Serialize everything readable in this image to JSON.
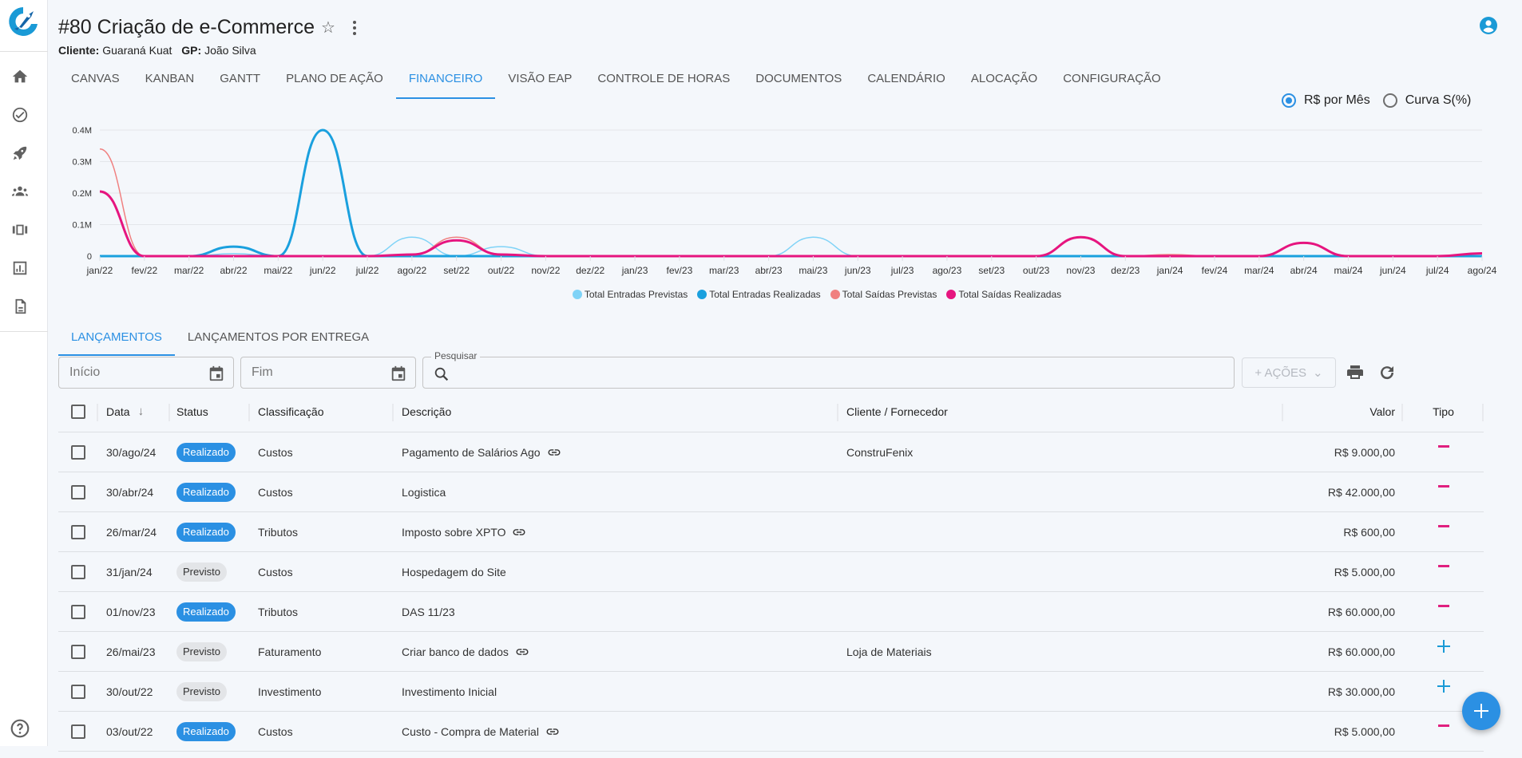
{
  "header": {
    "title": "#80 Criação de e-Commerce",
    "client_label": "Cliente:",
    "client_value": "Guaraná Kuat",
    "gp_label": "GP:",
    "gp_value": "João Silva"
  },
  "sidebar": {
    "items": [
      {
        "name": "home-icon"
      },
      {
        "name": "check-circle-icon"
      },
      {
        "name": "rocket-icon"
      },
      {
        "name": "groups-icon"
      },
      {
        "name": "view-carousel-icon"
      },
      {
        "name": "chart-icon"
      },
      {
        "name": "document-icon"
      }
    ],
    "help": "help-icon"
  },
  "tabs": [
    {
      "label": "CANVAS",
      "active": false
    },
    {
      "label": "KANBAN",
      "active": false
    },
    {
      "label": "GANTT",
      "active": false
    },
    {
      "label": "PLANO DE AÇÃO",
      "active": false
    },
    {
      "label": "FINANCEIRO",
      "active": true
    },
    {
      "label": "VISÃO EAP",
      "active": false
    },
    {
      "label": "CONTROLE DE HORAS",
      "active": false
    },
    {
      "label": "DOCUMENTOS",
      "active": false
    },
    {
      "label": "CALENDÁRIO",
      "active": false
    },
    {
      "label": "ALOCAÇÃO",
      "active": false
    },
    {
      "label": "CONFIGURAÇÃO",
      "active": false
    }
  ],
  "chart_mode": {
    "options": [
      {
        "label": "R$ por Mês",
        "checked": true
      },
      {
        "label": "Curva S(%)",
        "checked": false
      }
    ]
  },
  "chart_data": {
    "type": "line",
    "title": "",
    "xlabel": "",
    "ylabel": "",
    "ylim": [
      0,
      400000
    ],
    "yticks": [
      0,
      100000,
      200000,
      300000,
      400000
    ],
    "ytick_labels": [
      "0",
      "0.1M",
      "0.2M",
      "0.3M",
      "0.4M"
    ],
    "grid": true,
    "legend_position": "bottom",
    "categories": [
      "jan/22",
      "fev/22",
      "mar/22",
      "abr/22",
      "mai/22",
      "jun/22",
      "jul/22",
      "ago/22",
      "set/22",
      "out/22",
      "nov/22",
      "dez/22",
      "jan/23",
      "fev/23",
      "mar/23",
      "abr/23",
      "mai/23",
      "jun/23",
      "jul/23",
      "ago/23",
      "set/23",
      "out/23",
      "nov/23",
      "dez/23",
      "jan/24",
      "fev/24",
      "mar/24",
      "abr/24",
      "mai/24",
      "jun/24",
      "jul/24",
      "ago/24"
    ],
    "series": [
      {
        "name": "Total Entradas Previstas",
        "color": "#7fd3f7",
        "width": 1.5,
        "values": [
          0,
          0,
          0,
          8000,
          0,
          0,
          0,
          60000,
          0,
          30000,
          0,
          0,
          0,
          0,
          0,
          0,
          60000,
          0,
          0,
          0,
          0,
          0,
          0,
          0,
          0,
          0,
          0,
          0,
          0,
          0,
          0,
          0
        ]
      },
      {
        "name": "Total Entradas Realizadas",
        "color": "#1aa0de",
        "width": 3,
        "values": [
          0,
          0,
          0,
          30000,
          0,
          400000,
          0,
          0,
          0,
          0,
          0,
          0,
          0,
          0,
          0,
          0,
          0,
          0,
          0,
          0,
          0,
          0,
          0,
          0,
          0,
          0,
          0,
          0,
          0,
          0,
          0,
          0
        ]
      },
      {
        "name": "Total Saídas Previstas",
        "color": "#f08080",
        "width": 1.5,
        "values": [
          340000,
          0,
          0,
          0,
          0,
          0,
          0,
          5000,
          60000,
          5000,
          0,
          0,
          0,
          0,
          0,
          0,
          0,
          0,
          0,
          0,
          0,
          0,
          60000,
          0,
          5000,
          0,
          0,
          42000,
          0,
          0,
          0,
          9000
        ]
      },
      {
        "name": "Total Saídas Realizadas",
        "color": "#e6157f",
        "width": 3,
        "values": [
          205000,
          0,
          0,
          0,
          0,
          0,
          0,
          5000,
          50000,
          5000,
          0,
          0,
          0,
          0,
          0,
          0,
          0,
          0,
          0,
          0,
          0,
          0,
          60000,
          0,
          0,
          0,
          0,
          42000,
          0,
          0,
          0,
          9000
        ]
      }
    ]
  },
  "subtabs": [
    {
      "label": "LANÇAMENTOS",
      "active": true
    },
    {
      "label": "LANÇAMENTOS POR ENTREGA",
      "active": false
    }
  ],
  "filters": {
    "start_placeholder": "Início",
    "end_placeholder": "Fim",
    "search_label": "Pesquisar",
    "search_value": "",
    "actions_label": "+ AÇÕES"
  },
  "table": {
    "columns": {
      "date": "Data",
      "status": "Status",
      "classification": "Classificação",
      "description": "Descrição",
      "client": "Cliente / Fornecedor",
      "value": "Valor",
      "type": "Tipo"
    },
    "rows": [
      {
        "date": "30/ago/24",
        "status": "Realizado",
        "classification": "Custos",
        "description": "Pagamento de Salários Ago",
        "has_link": true,
        "client": "ConstruFenix",
        "value": "R$ 9.000,00",
        "type": "saida"
      },
      {
        "date": "30/abr/24",
        "status": "Realizado",
        "classification": "Custos",
        "description": "Logistica",
        "has_link": false,
        "client": "",
        "value": "R$ 42.000,00",
        "type": "saida"
      },
      {
        "date": "26/mar/24",
        "status": "Realizado",
        "classification": "Tributos",
        "description": "Imposto sobre XPTO",
        "has_link": true,
        "client": "",
        "value": "R$ 600,00",
        "type": "saida"
      },
      {
        "date": "31/jan/24",
        "status": "Previsto",
        "classification": "Custos",
        "description": "Hospedagem do Site",
        "has_link": false,
        "client": "",
        "value": "R$ 5.000,00",
        "type": "saida"
      },
      {
        "date": "01/nov/23",
        "status": "Realizado",
        "classification": "Tributos",
        "description": "DAS 11/23",
        "has_link": false,
        "client": "",
        "value": "R$ 60.000,00",
        "type": "saida"
      },
      {
        "date": "26/mai/23",
        "status": "Previsto",
        "classification": "Faturamento",
        "description": "Criar banco de dados",
        "has_link": true,
        "client": "Loja de Materiais",
        "value": "R$ 60.000,00",
        "type": "entrada"
      },
      {
        "date": "30/out/22",
        "status": "Previsto",
        "classification": "Investimento",
        "description": "Investimento Inicial",
        "has_link": false,
        "client": "",
        "value": "R$ 30.000,00",
        "type": "entrada"
      },
      {
        "date": "03/out/22",
        "status": "Realizado",
        "classification": "Custos",
        "description": "Custo - Compra de Material",
        "has_link": true,
        "client": "",
        "value": "R$ 5.000,00",
        "type": "saida"
      }
    ]
  },
  "colors": {
    "accent": "#2b90e3",
    "entrada": "#1a9ad6",
    "saida": "#e0207f"
  }
}
